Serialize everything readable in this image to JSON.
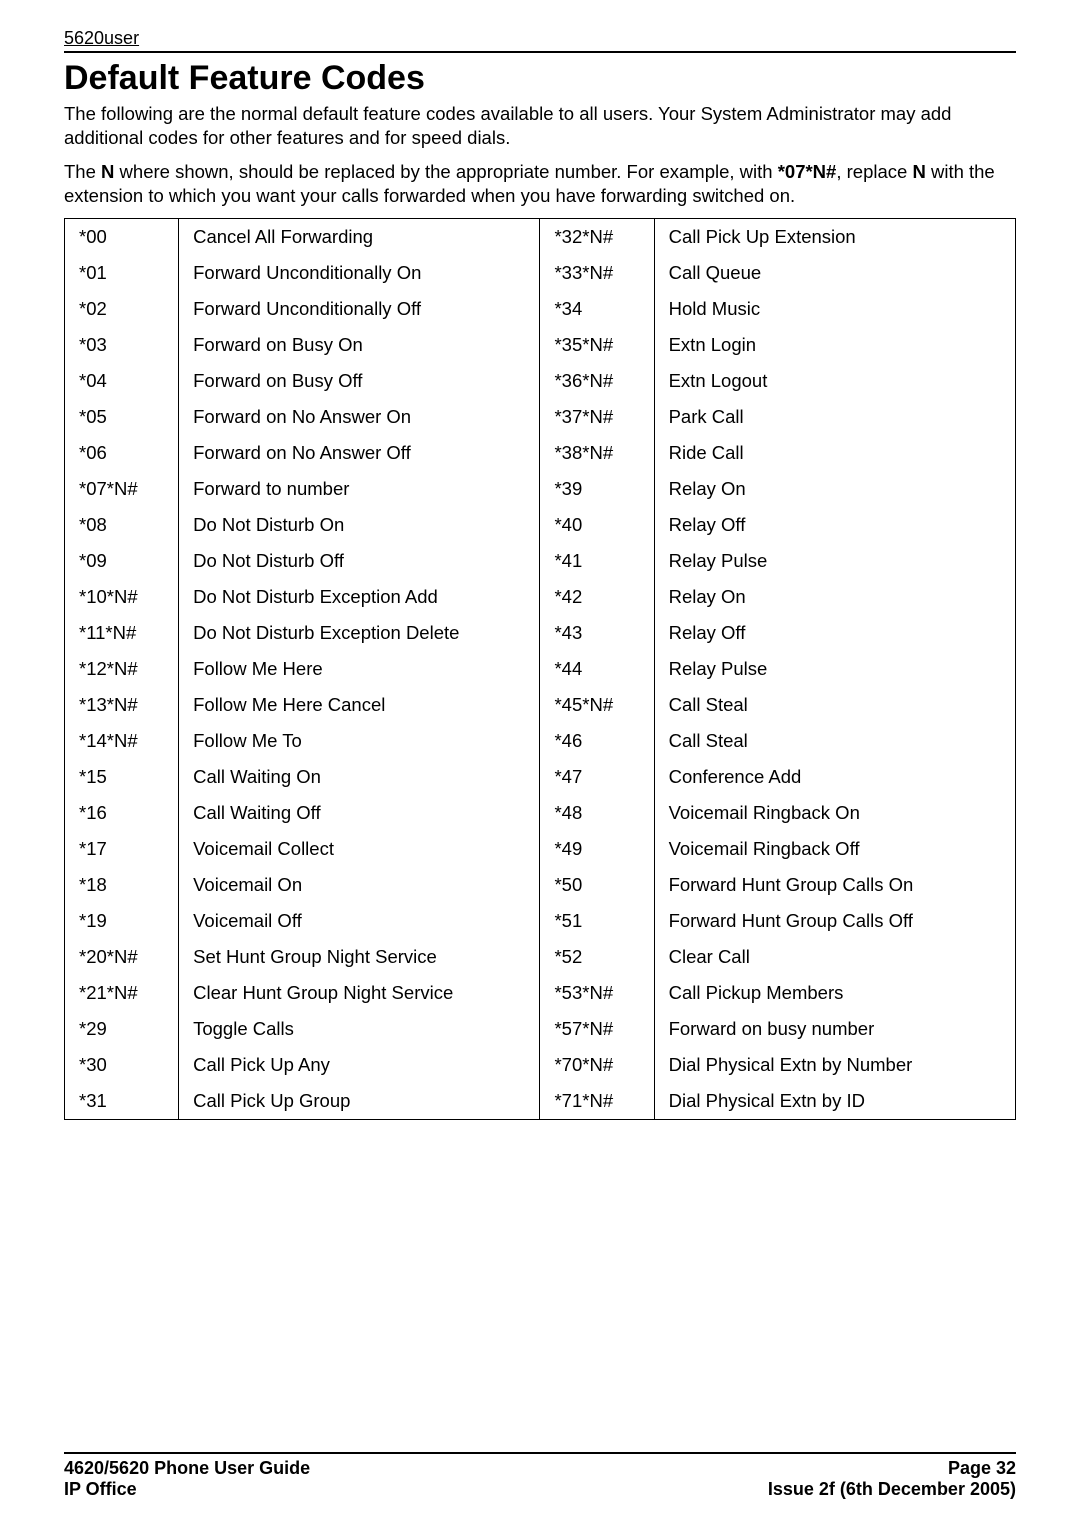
{
  "header": {
    "doc_id": "5620user"
  },
  "title": "Default Feature Codes",
  "intro": "The following are the normal default feature codes available to all users. Your System Administrator may add additional codes for other features and for speed dials.",
  "note_parts": {
    "p1": "The ",
    "n1": "N",
    "p2": " where shown, should be replaced by the appropriate number. For example, with ",
    "ex": "*07*N#",
    "p3": ", replace ",
    "n2": "N",
    "p4": " with the extension to which you want your calls forwarded when you have forwarding switched on."
  },
  "rows": [
    {
      "c1": "*00",
      "d1": "Cancel All Forwarding",
      "c2": "*32*N#",
      "d2": "Call Pick Up Extension"
    },
    {
      "c1": "*01",
      "d1": "Forward Unconditionally On",
      "c2": "*33*N#",
      "d2": "Call Queue"
    },
    {
      "c1": "*02",
      "d1": "Forward Unconditionally Off",
      "c2": "*34",
      "d2": "Hold Music"
    },
    {
      "c1": "*03",
      "d1": "Forward on Busy On",
      "c2": "*35*N#",
      "d2": "Extn Login"
    },
    {
      "c1": "*04",
      "d1": "Forward on Busy Off",
      "c2": "*36*N#",
      "d2": "Extn Logout"
    },
    {
      "c1": "*05",
      "d1": "Forward on No Answer On",
      "c2": "*37*N#",
      "d2": "Park Call"
    },
    {
      "c1": "*06",
      "d1": "Forward on No Answer Off",
      "c2": "*38*N#",
      "d2": "Ride Call"
    },
    {
      "c1": "*07*N#",
      "d1": "Forward to number",
      "c2": "*39",
      "d2": "Relay On"
    },
    {
      "c1": "*08",
      "d1": "Do Not Disturb On",
      "c2": "*40",
      "d2": "Relay Off"
    },
    {
      "c1": "*09",
      "d1": "Do Not Disturb Off",
      "c2": "*41",
      "d2": "Relay Pulse"
    },
    {
      "c1": "*10*N#",
      "d1": "Do Not Disturb Exception Add",
      "c2": "*42",
      "d2": "Relay On"
    },
    {
      "c1": "*11*N#",
      "d1": "Do Not Disturb Exception Delete",
      "c2": "*43",
      "d2": "Relay Off"
    },
    {
      "c1": "*12*N#",
      "d1": "Follow Me Here",
      "c2": "*44",
      "d2": "Relay Pulse"
    },
    {
      "c1": "*13*N#",
      "d1": "Follow Me Here Cancel",
      "c2": "*45*N#",
      "d2": "Call Steal"
    },
    {
      "c1": "*14*N#",
      "d1": "Follow Me To",
      "c2": "*46",
      "d2": "Call Steal"
    },
    {
      "c1": "*15",
      "d1": "Call Waiting On",
      "c2": "*47",
      "d2": "Conference Add"
    },
    {
      "c1": "*16",
      "d1": "Call Waiting Off",
      "c2": "*48",
      "d2": "Voicemail Ringback On"
    },
    {
      "c1": "*17",
      "d1": "Voicemail Collect",
      "c2": "*49",
      "d2": "Voicemail Ringback Off"
    },
    {
      "c1": "*18",
      "d1": "Voicemail On",
      "c2": "*50",
      "d2": "Forward Hunt Group Calls On"
    },
    {
      "c1": "*19",
      "d1": "Voicemail Off",
      "c2": "*51",
      "d2": "Forward Hunt Group Calls Off"
    },
    {
      "c1": "*20*N#",
      "d1": "Set Hunt Group Night Service",
      "c2": "*52",
      "d2": "Clear Call"
    },
    {
      "c1": "*21*N#",
      "d1": "Clear Hunt Group Night Service",
      "c2": "*53*N#",
      "d2": "Call Pickup Members"
    },
    {
      "c1": "*29",
      "d1": "Toggle Calls",
      "c2": "*57*N#",
      "d2": "Forward on busy number"
    },
    {
      "c1": "*30",
      "d1": "Call Pick Up Any",
      "c2": "*70*N#",
      "d2": "Dial Physical Extn by Number"
    },
    {
      "c1": "*31",
      "d1": "Call Pick Up Group",
      "c2": "*71*N#",
      "d2": "Dial Physical Extn by ID"
    }
  ],
  "footer": {
    "left1": "4620/5620 Phone User Guide",
    "left2": "IP Office",
    "right1": "Page 32",
    "right2": "Issue 2f (6th December 2005)"
  }
}
